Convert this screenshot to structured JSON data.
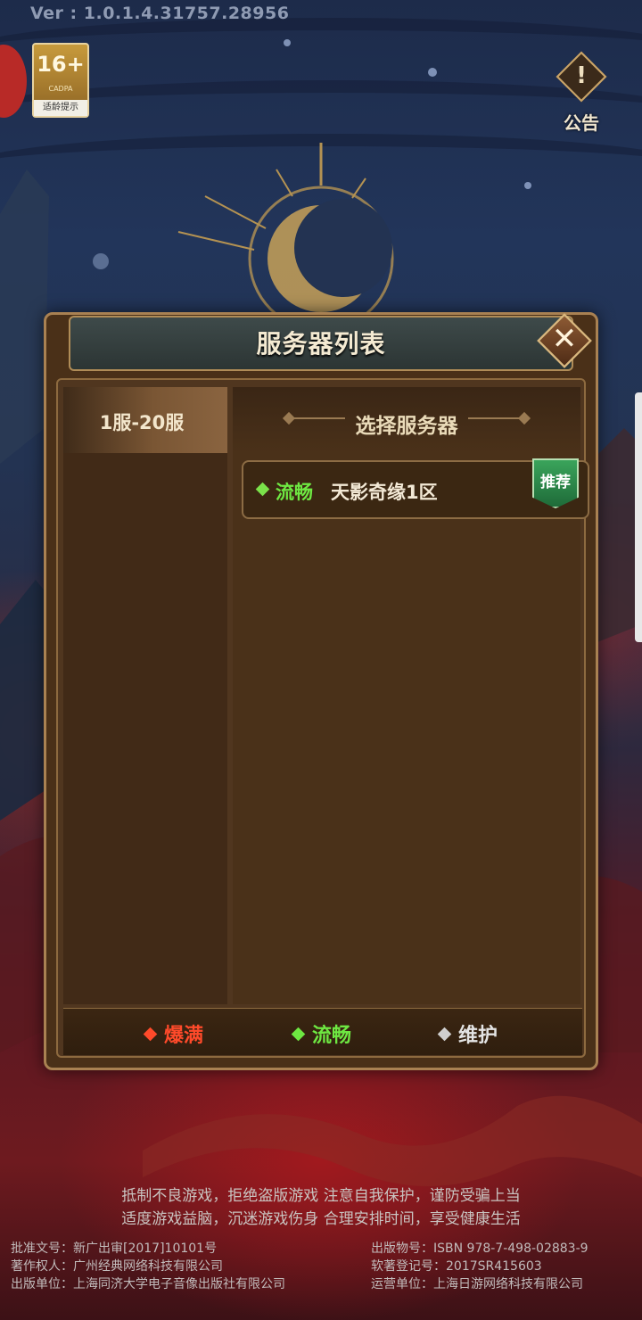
{
  "version_text": "Ver : 1.0.1.4.31757.28956",
  "age_rating": {
    "number": "16+",
    "org": "CADPA",
    "label": "适龄提示"
  },
  "notice_button": {
    "icon": "!",
    "label": "公告"
  },
  "dialog": {
    "title": "服务器列表",
    "close_icon": "✕",
    "server_range_tab": "1服-20服",
    "select_server_header": "选择服务器",
    "servers": [
      {
        "status": "流畅",
        "name": "天影奇缘1区",
        "badge": "推荐"
      }
    ],
    "legend": [
      {
        "label": "爆满",
        "color": "#ff4a2a"
      },
      {
        "label": "流畅",
        "color": "#6ee842"
      },
      {
        "label": "维护",
        "color": "#cfcfcf"
      }
    ]
  },
  "health_notice": {
    "line1": "抵制不良游戏，拒绝盗版游戏   注意自我保护，谨防受骗上当",
    "line2": "适度游戏益脑，沉迷游戏伤身   合理安排时间，享受健康生活"
  },
  "footer": {
    "left": [
      "批准文号：新广出审[2017]10101号",
      "著作权人：广州经典网络科技有限公司",
      "出版单位：上海同济大学电子音像出版社有限公司"
    ],
    "right": [
      "出版物号：ISBN  978-7-498-02883-9",
      "软著登记号：2017SR415603",
      "运营单位：上海日游网络科技有限公司"
    ]
  }
}
